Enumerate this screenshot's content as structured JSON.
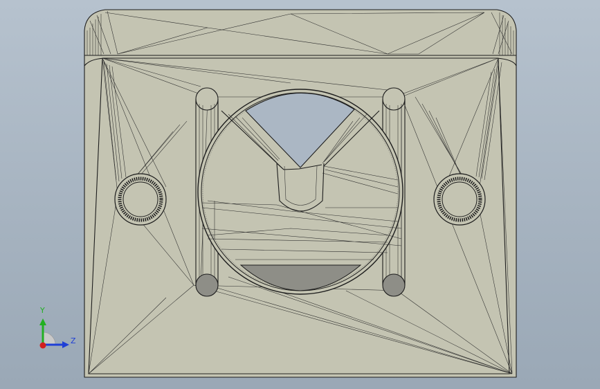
{
  "viewport": {
    "background_top": "#b6c2ce",
    "background_bottom": "#9aa8b6",
    "model_face_color": "#c4c4b2",
    "model_edge_color": "#1c1c1c"
  },
  "triad": {
    "y_label": "Y",
    "z_label": "Z",
    "y_color": "#22b022",
    "z_color": "#1f3fd6",
    "x_color": "#d21f1f"
  }
}
